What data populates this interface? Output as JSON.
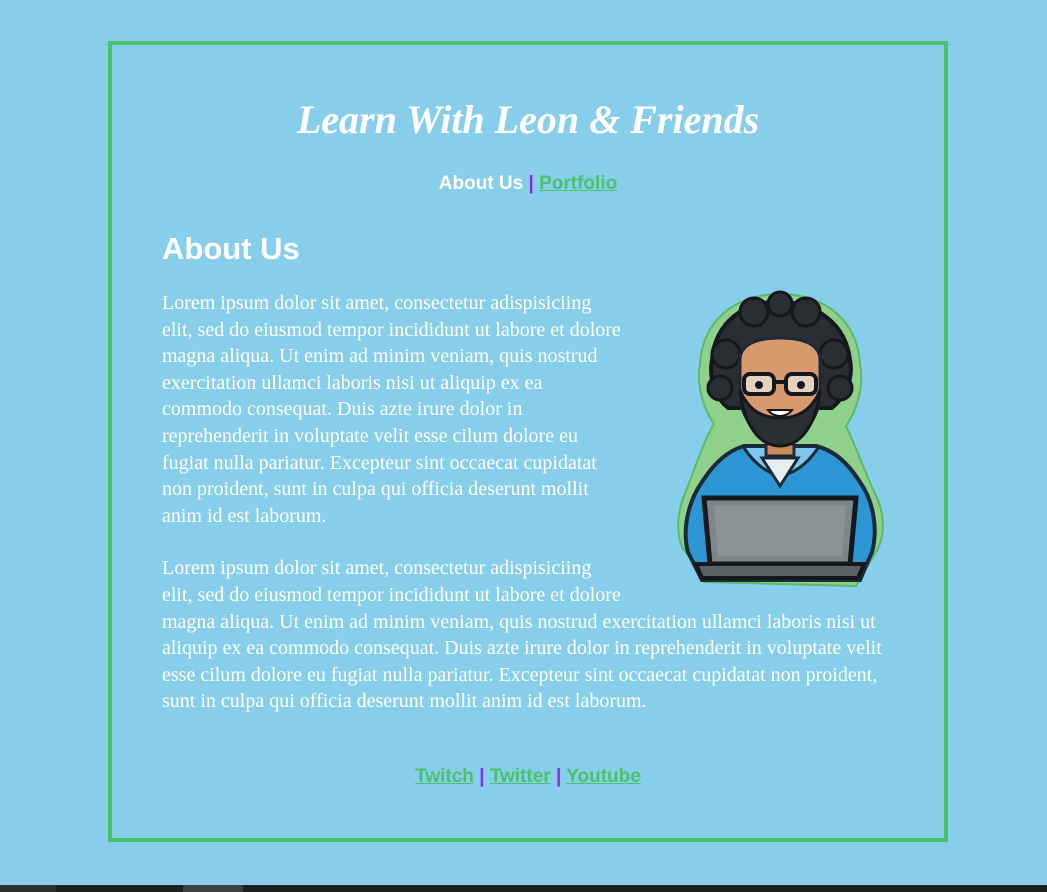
{
  "header": {
    "title": "Learn With Leon & Friends"
  },
  "nav": {
    "current_label": "About Us",
    "separator": "|",
    "portfolio_label": "Portfolio"
  },
  "main": {
    "heading": "About Us",
    "paragraphs": [
      "Lorem ipsum dolor sit amet, consectetur adispisiciing elit, sed do eiusmod tempor incididunt ut labore et dolore magna aliqua. Ut enim ad minim veniam, quis nostrud exercitation ullamci laboris nisi ut aliquip ex ea commodo consequat. Duis azte irure dolor in reprehenderit in voluptate velit esse cilum dolore eu fugiat nulla pariatur. Excepteur sint occaecat cupidatat non proident, sunt in culpa qui officia deserunt mollit anim id est laborum.",
      "Lorem ipsum dolor sit amet, consectetur adispisiciing elit, sed do eiusmod tempor incididunt ut labore et dolore magna aliqua. Ut enim ad minim veniam, quis nostrud exercitation ullamci laboris nisi ut aliquip ex ea commodo consequat. Duis azte irure dolor in reprehenderit in voluptate velit esse cilum dolore eu fugiat nulla pariatur. Excepteur sint occaecat cupidatat non proident, sunt in culpa qui officia deserunt mollit anim id est laborum."
    ],
    "image_icon": "developer-avatar-illustration"
  },
  "footer": {
    "separator": "|",
    "links": [
      "Twitch",
      "Twitter",
      "Youtube"
    ]
  },
  "colors": {
    "background": "#87ceeb",
    "border": "#4bc26e",
    "link": "#4bc26e",
    "separator": "#8a2be2",
    "text": "#ffffff"
  }
}
